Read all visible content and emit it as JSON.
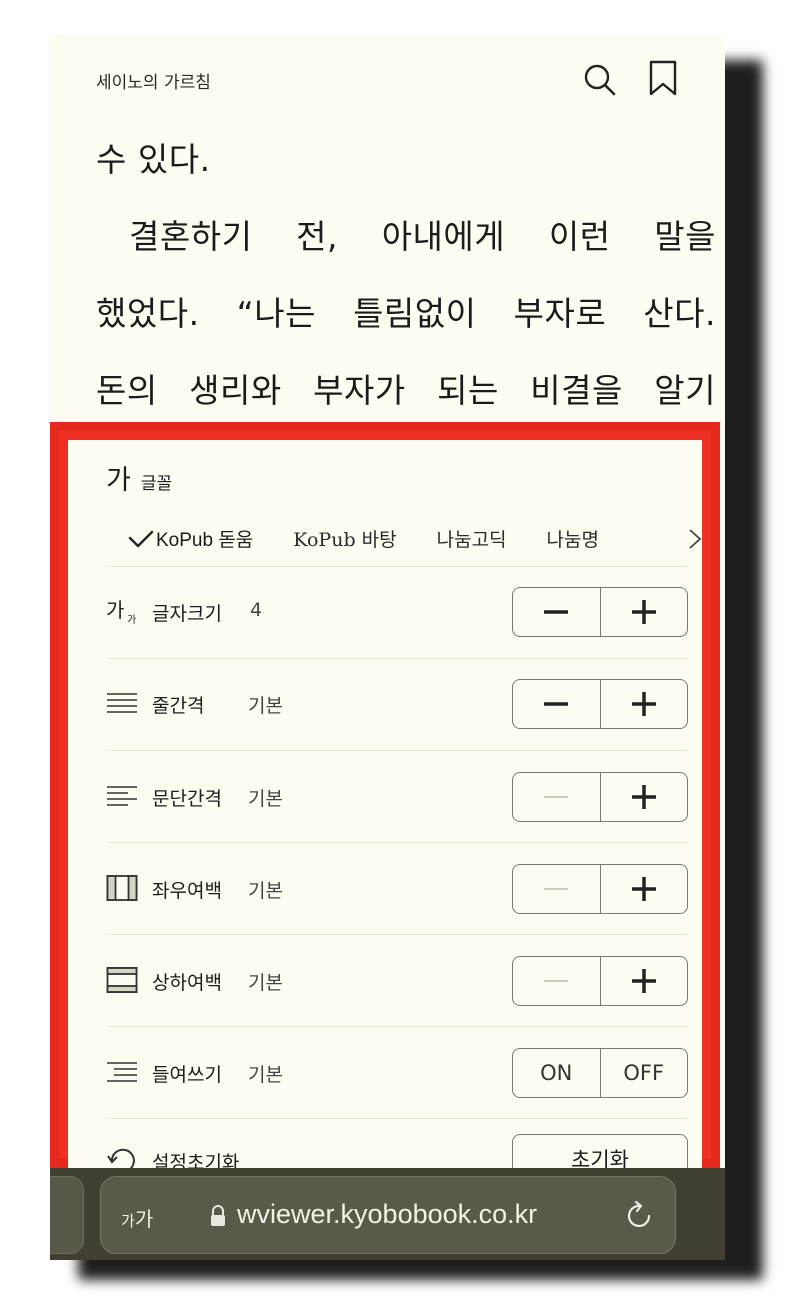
{
  "header": {
    "book_title": "세이노의 가르침"
  },
  "reader": {
    "lines": [
      "수 있다.",
      "결혼하기 전, 아내에게 이런 말을",
      "했었다. “나는 틀림없이 부자로 산다.",
      "돈의 생리와 부자가 되는 비결을 알기"
    ]
  },
  "settings": {
    "font": {
      "icon_glyph": "가",
      "label": "글꼴",
      "options": [
        "KoPub 돋움",
        "KoPub 바탕",
        "나눔고딕",
        "나눔명"
      ],
      "selected": "KoPub 돋움"
    },
    "font_size": {
      "label": "글자크기",
      "value": "4",
      "minus": "−",
      "plus": "+"
    },
    "line_spacing": {
      "label": "줄간격",
      "value": "기본"
    },
    "paragraph_spacing": {
      "label": "문단간격",
      "value": "기본"
    },
    "side_margin": {
      "label": "좌우여백",
      "value": "기본"
    },
    "vertical_margin": {
      "label": "상하여백",
      "value": "기본"
    },
    "indent": {
      "label": "들여쓰기",
      "value": "기본",
      "on": "ON",
      "off": "OFF"
    },
    "reset": {
      "label": "설정초기화",
      "button": "초기화"
    }
  },
  "browser": {
    "text_size_label_small": "가",
    "text_size_label_big": "가",
    "url": "wviewer.kyobobook.co.kr"
  }
}
